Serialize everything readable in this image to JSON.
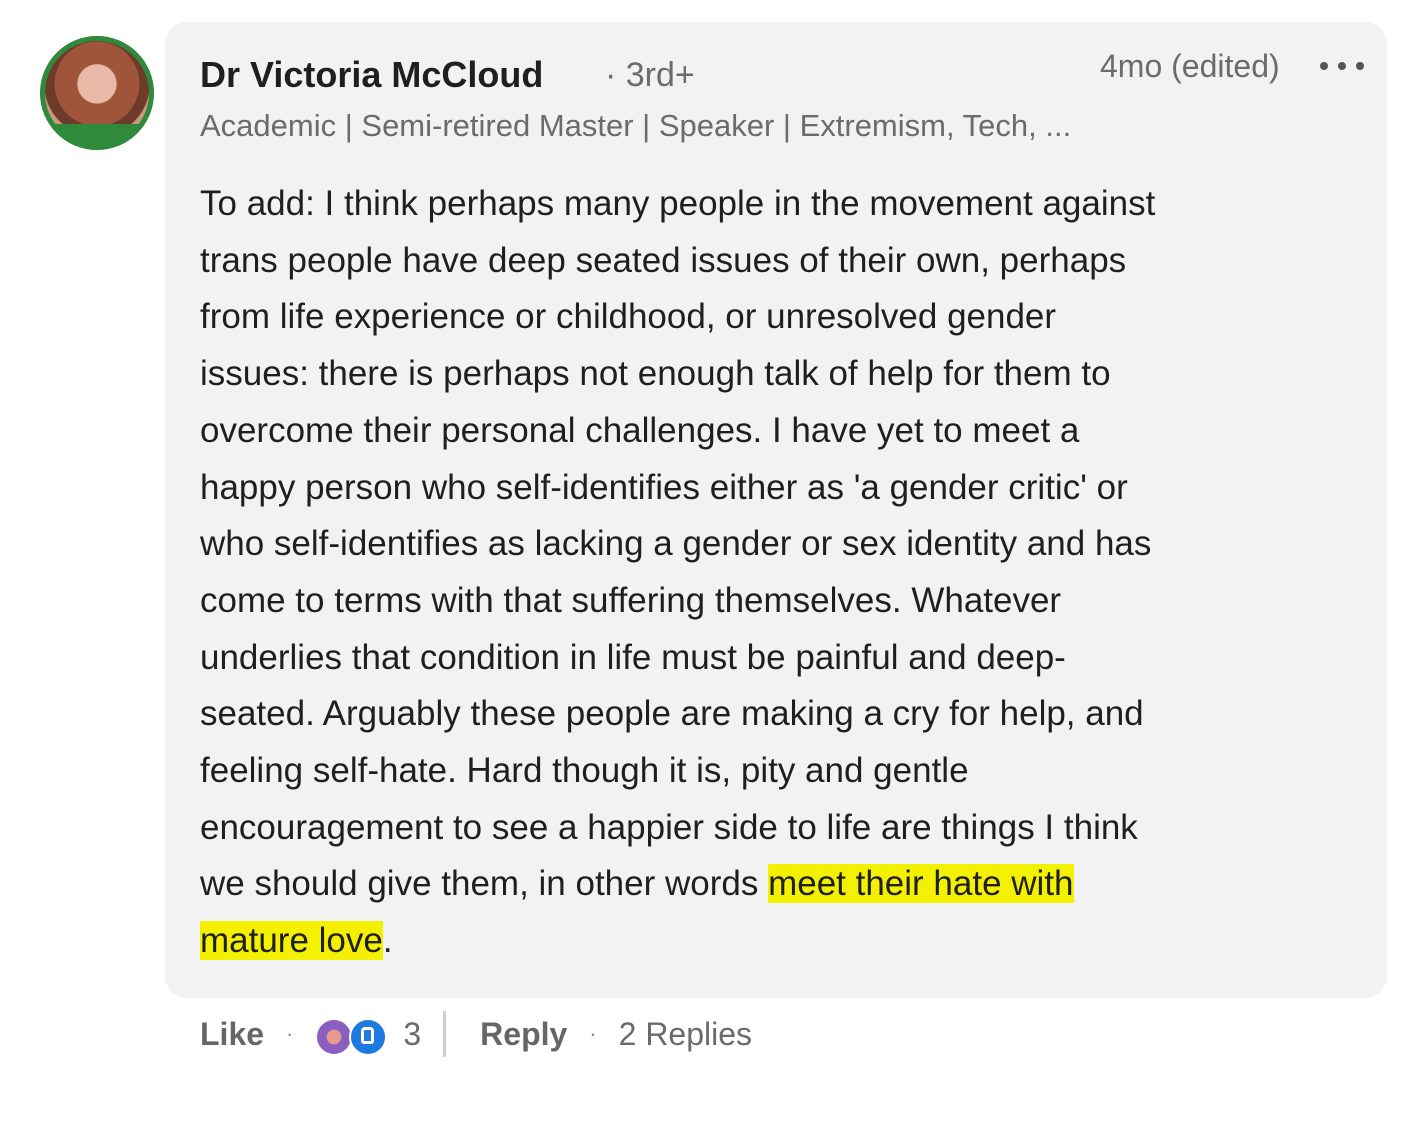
{
  "comment": {
    "author_name": "Dr Victoria McCloud",
    "connection_degree": "· 3rd+",
    "timestamp": "4mo (edited)",
    "headline": "Academic | Semi-retired Master | Speaker | Extremism, Tech, ...",
    "body_lines": [
      "To add: I think perhaps many people in the movement against",
      "trans people have deep seated issues of their own, perhaps",
      "from life experience or childhood, or unresolved gender",
      "issues: there is perhaps not enough talk of help for them to",
      "overcome their personal challenges. I have yet to meet a",
      "happy person who self-identifies either as 'a gender critic' or",
      "who self-identifies as lacking a gender or sex identity and has",
      "come to terms with that suffering themselves. Whatever",
      "underlies that condition in life must be painful and deep-",
      "seated. Arguably these people are making a cry for help, and",
      "feeling self-hate. Hard though it is, pity and gentle",
      "encouragement to see a happier side to life are things I think"
    ],
    "line13_plain": "we should give them, in other words ",
    "line13_highlight": "meet their hate with",
    "line14_highlight": "mature love",
    "line14_plain": ".",
    "highlight_color": "#f4f100"
  },
  "actions": {
    "like_label": "Like",
    "separator": "·",
    "reaction_icons": [
      "love-reaction-icon",
      "like-reaction-icon"
    ],
    "reaction_count": "3",
    "reply_label": "Reply",
    "replies_label": "2 Replies"
  }
}
